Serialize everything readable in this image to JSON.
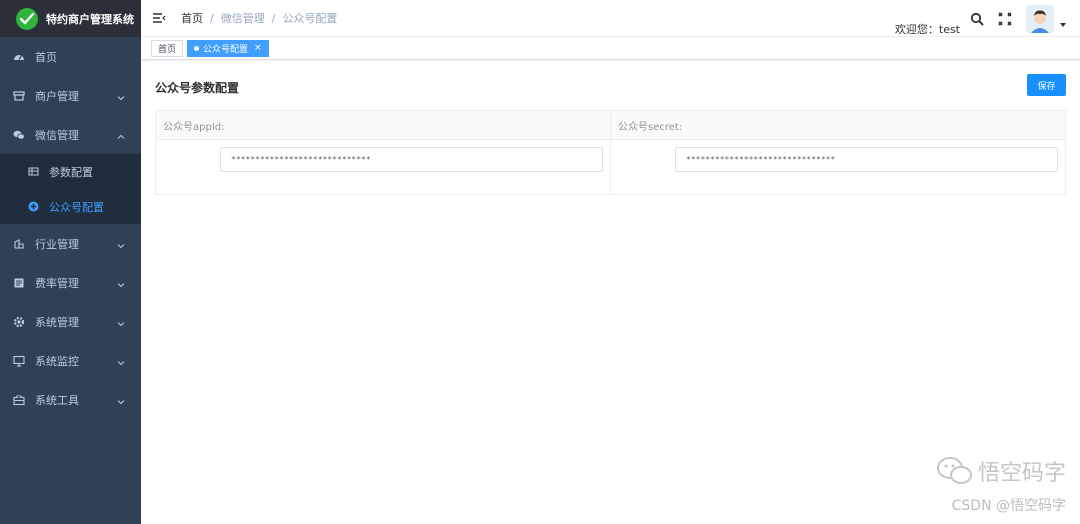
{
  "app": {
    "title": "特约商户管理系统",
    "brand_color": "#2fb53c"
  },
  "sidebar": {
    "items": [
      {
        "label": "首页",
        "icon": "dashboard-icon",
        "has_arrow": false
      },
      {
        "label": "商户管理",
        "icon": "shop-icon",
        "has_arrow": true
      },
      {
        "label": "微信管理",
        "icon": "wechat-icon",
        "has_arrow": true,
        "expanded": true,
        "children": [
          {
            "label": "参数配置",
            "icon": "table-icon",
            "active": false
          },
          {
            "label": "公众号配置",
            "icon": "plus-circle-icon",
            "active": true
          }
        ]
      },
      {
        "label": "行业管理",
        "icon": "industry-icon",
        "has_arrow": true
      },
      {
        "label": "费率管理",
        "icon": "rate-icon",
        "has_arrow": true
      },
      {
        "label": "系统管理",
        "icon": "gear-icon",
        "has_arrow": true
      },
      {
        "label": "系统监控",
        "icon": "monitor-icon",
        "has_arrow": true
      },
      {
        "label": "系统工具",
        "icon": "toolbox-icon",
        "has_arrow": true
      }
    ]
  },
  "header": {
    "breadcrumb": [
      "首页",
      "微信管理",
      "公众号配置"
    ],
    "breadcrumb_sep": "/",
    "welcome": "欢迎您：test"
  },
  "tags": [
    {
      "label": "首页",
      "active": false
    },
    {
      "label": "公众号配置",
      "active": true,
      "close": "×"
    }
  ],
  "main": {
    "title": "公众号参数配置",
    "save_label": "保存",
    "fields": [
      {
        "label": "公众号appId:",
        "value": "*****************************"
      },
      {
        "label": "公众号secret:",
        "value": "*******************************"
      }
    ]
  },
  "watermark": {
    "line1": "悟空码字",
    "line2": "CSDN @悟空码字"
  },
  "colors": {
    "sidebar_bg": "#304156",
    "submenu_bg": "#1f2d3d",
    "accent": "#409eff",
    "button": "#1890ff"
  }
}
